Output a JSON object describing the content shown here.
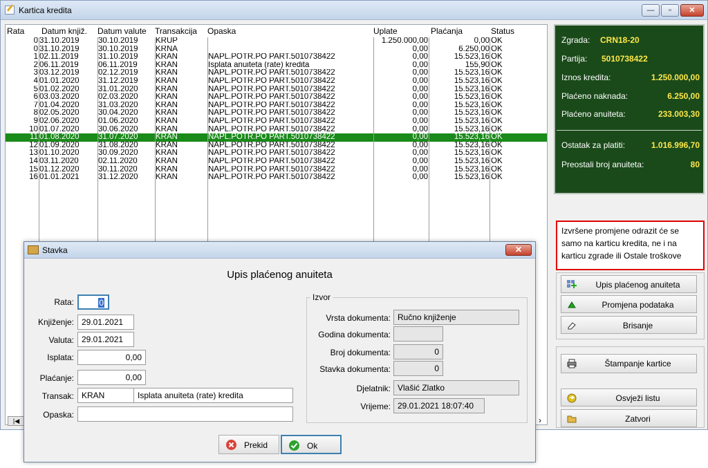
{
  "window": {
    "title": "Kartica kredita"
  },
  "table": {
    "headers": [
      "Rata",
      "Datum knjiž.",
      "Datum valute",
      "Transakcija",
      "Opaska",
      "Uplate",
      "Plaćanja",
      "Status"
    ],
    "rows": [
      [
        "0",
        "31.10.2019",
        "30.10.2019",
        "KRUP",
        "",
        "1.250.000,00",
        "0,00",
        "OK"
      ],
      [
        "0",
        "31.10.2019",
        "30.10.2019",
        "KRNA",
        "",
        "0,00",
        "6.250,00",
        "OK"
      ],
      [
        "1",
        "02.11.2019",
        "31.10.2019",
        "KRAN",
        "NAPL.POTR.PO PART.5010738422",
        "0,00",
        "15.523,16",
        "OK"
      ],
      [
        "2",
        "06.11.2019",
        "06.11.2019",
        "KRAN",
        "Isplata anuiteta (rate) kredita",
        "0,00",
        "155,90",
        "OK"
      ],
      [
        "3",
        "03.12.2019",
        "02.12.2019",
        "KRAN",
        "NAPL.POTR.PO PART.5010738422",
        "0,00",
        "15.523,16",
        "OK"
      ],
      [
        "4",
        "01.01.2020",
        "31.12.2019",
        "KRAN",
        "NAPL.POTR.PO PART.5010738422",
        "0,00",
        "15.523,16",
        "OK"
      ],
      [
        "5",
        "01.02.2020",
        "31.01.2020",
        "KRAN",
        "NAPL.POTR.PO PART.5010738422",
        "0,00",
        "15.523,16",
        "OK"
      ],
      [
        "6",
        "03.03.2020",
        "02.03.2020",
        "KRAN",
        "NAPL.POTR.PO PART.5010738422",
        "0,00",
        "15.523,16",
        "OK"
      ],
      [
        "7",
        "01.04.2020",
        "31.03.2020",
        "KRAN",
        "NAPL.POTR.PO PART.5010738422",
        "0,00",
        "15.523,16",
        "OK"
      ],
      [
        "8",
        "02.05.2020",
        "30.04.2020",
        "KRAN",
        "NAPL.POTR.PO PART.5010738422",
        "0,00",
        "15.523,16",
        "OK"
      ],
      [
        "9",
        "02.06.2020",
        "01.06.2020",
        "KRAN",
        "NAPL.POTR.PO PART.5010738422",
        "0,00",
        "15.523,16",
        "OK"
      ],
      [
        "10",
        "01.07.2020",
        "30.06.2020",
        "KRAN",
        "NAPL.POTR.PO PART.5010738422",
        "0,00",
        "15.523,16",
        "OK"
      ],
      [
        "11",
        "01.08.2020",
        "31.07.2020",
        "KRAN",
        "NAPL.POTR.PO PART.5010738422",
        "0,00",
        "15.523,16",
        "OK"
      ],
      [
        "12",
        "01.09.2020",
        "31.08.2020",
        "KRAN",
        "NAPL.POTR.PO PART.5010738422",
        "0,00",
        "15.523,16",
        "OK"
      ],
      [
        "13",
        "01.10.2020",
        "30.09.2020",
        "KRAN",
        "NAPL.POTR.PO PART.5010738422",
        "0,00",
        "15.523,16",
        "OK"
      ],
      [
        "14",
        "03.11.2020",
        "02.11.2020",
        "KRAN",
        "NAPL.POTR.PO PART.5010738422",
        "0,00",
        "15.523,16",
        "OK"
      ],
      [
        "15",
        "01.12.2020",
        "30.11.2020",
        "KRAN",
        "NAPL.POTR.PO PART.5010738422",
        "0,00",
        "15.523,16",
        "OK"
      ],
      [
        "16",
        "01.01.2021",
        "31.12.2020",
        "KRAN",
        "NAPL.POTR.PO PART.5010738422",
        "0,00",
        "15.523,16",
        "OK"
      ]
    ],
    "selected_row": 12
  },
  "info": {
    "zgrada_label": "Zgrada:",
    "zgrada": "CRN18-20",
    "partija_label": "Partija:",
    "partija": "5010738422",
    "iznos_label": "Iznos kredita:",
    "iznos": "1.250.000,00",
    "naknada_label": "Plaćeno naknada:",
    "naknada": "6.250,00",
    "anuiteta_label": "Plaćeno anuiteta:",
    "anuiteta": "233.003,30",
    "ostatak_label": "Ostatak za platiti:",
    "ostatak": "1.016.996,70",
    "preostali_label": "Preostali broj anuiteta:",
    "preostali": "80"
  },
  "note": "Izvršene promjene odrazit će se samo na karticu kredita, ne i na karticu zgrade ili Ostale troškove",
  "buttons": {
    "upis": "Upis plaćenog anuiteta",
    "promjena": "Promjena podataka",
    "brisanje": "Brisanje",
    "stampanje": "Štampanje kartice",
    "osvjezi": "Osvježi listu",
    "zatvori": "Zatvori"
  },
  "dialog": {
    "title": "Stavka",
    "heading": "Upis plaćenog anuiteta",
    "rata_label": "Rata:",
    "rata": "0",
    "knjizenje_label": "Knjiženje:",
    "knjizenje": "29.01.2021",
    "valuta_label": "Valuta:",
    "valuta": "29.01.2021",
    "isplata_label": "Isplata:",
    "isplata": "0,00",
    "placanje_label": "Plaćanje:",
    "placanje": "0,00",
    "transak_label": "Transak:",
    "transak_code": "KRAN",
    "transak_desc": "Isplata anuiteta (rate) kredita",
    "opaska_label": "Opaska:",
    "opaska": "",
    "izvor_label": "Izvor",
    "vrsta_label": "Vrsta dokumenta:",
    "vrsta": "Ručno knjiženje",
    "godina_label": "Godina dokumenta:",
    "godina": "",
    "broj_label": "Broj dokumenta:",
    "broj": "0",
    "stavka_label": "Stavka dokumenta:",
    "stavka": "0",
    "djelatnik_label": "Djelatnik:",
    "djelatnik": "Vlašić Zlatko",
    "vrijeme_label": "Vrijeme:",
    "vrijeme": "29.01.2021 18:07:40",
    "prekid": "Prekid",
    "ok": "Ok"
  },
  "colors": {
    "selection": "#1a8a1a",
    "info_bg": "#1a4a1a",
    "info_value": "#ffe84a",
    "note_border": "#e00000"
  }
}
